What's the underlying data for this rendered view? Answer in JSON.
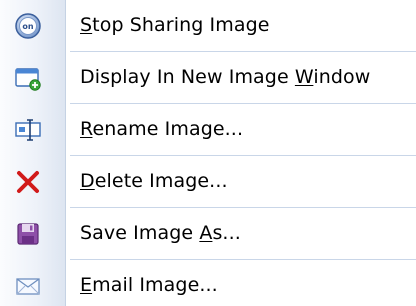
{
  "menu": {
    "items": [
      {
        "label": "Stop Sharing Image",
        "mnemonic": "S",
        "icon": "share-stop-icon"
      },
      {
        "label": "Display In New Image Window",
        "mnemonic": "W",
        "icon": "new-window-icon"
      },
      {
        "label": "Rename Image...",
        "mnemonic": "R",
        "icon": "rename-icon"
      },
      {
        "label": "Delete Image...",
        "mnemonic": "D",
        "icon": "delete-icon"
      },
      {
        "label": "Save Image As...",
        "mnemonic": "A",
        "icon": "save-icon"
      },
      {
        "label": "Email Image...",
        "mnemonic": "E",
        "icon": "email-icon"
      }
    ]
  },
  "colors": {
    "icon_column_start": "#fbfcfe",
    "icon_column_end": "#dde5f1",
    "separator": "#c9d6e8",
    "delete_icon": "#d11a1a"
  }
}
